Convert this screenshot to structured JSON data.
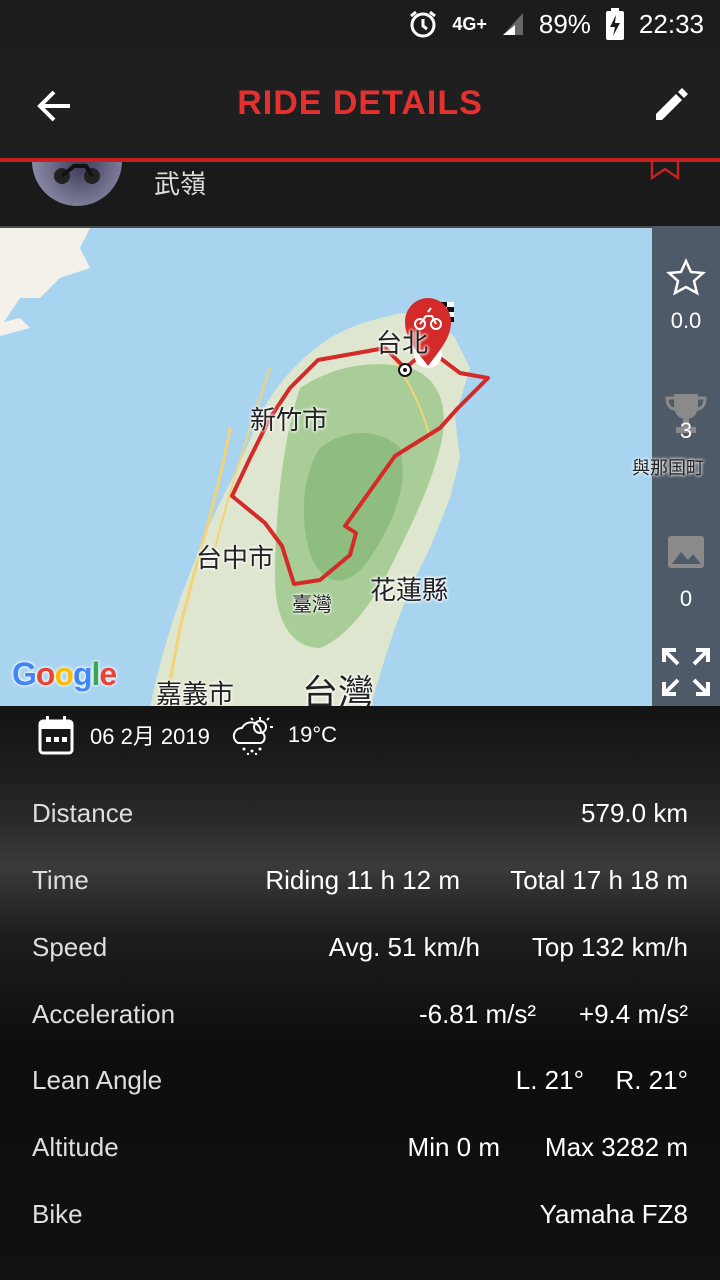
{
  "status_bar": {
    "network": "4G+",
    "battery": "89%",
    "time": "22:33",
    "icons": [
      "alarm-icon",
      "signal-icon",
      "battery-charging-icon"
    ]
  },
  "header": {
    "title": "RIDE DETAILS",
    "back_icon": "arrow-left-icon",
    "edit_icon": "pencil-icon"
  },
  "profile": {
    "name": "武嶺"
  },
  "map": {
    "labels": [
      "台北",
      "新竹市",
      "台中市",
      "臺灣",
      "花蓮縣",
      "嘉義市",
      "台灣"
    ],
    "watermark": "Google",
    "edge_label": "與那国町"
  },
  "side_panel": {
    "rating": "0.0",
    "trophies": "3",
    "photos": "0"
  },
  "ride": {
    "date": "06 2月 2019",
    "temperature": "19°C",
    "distance": {
      "label": "Distance",
      "value": "579.0 km"
    },
    "time": {
      "label": "Time",
      "riding": "Riding 11 h 12 m",
      "total": "Total 17 h 18 m"
    },
    "speed": {
      "label": "Speed",
      "avg": "Avg. 51 km/h",
      "top": "Top 132 km/h"
    },
    "acceleration": {
      "label": "Acceleration",
      "min": "-6.81 m/s²",
      "max": "+9.4 m/s²"
    },
    "lean_angle": {
      "label": "Lean Angle",
      "left": "L. 21°",
      "right": "R. 21°"
    },
    "altitude": {
      "label": "Altitude",
      "min": "Min 0 m",
      "max": "Max 3282 m"
    },
    "bike": {
      "label": "Bike",
      "value": "Yamaha FZ8"
    }
  },
  "colors": {
    "accent": "#e53030",
    "route": "#d42a2a",
    "sea": "#a9d4ef",
    "panel": "#4f5a68"
  }
}
